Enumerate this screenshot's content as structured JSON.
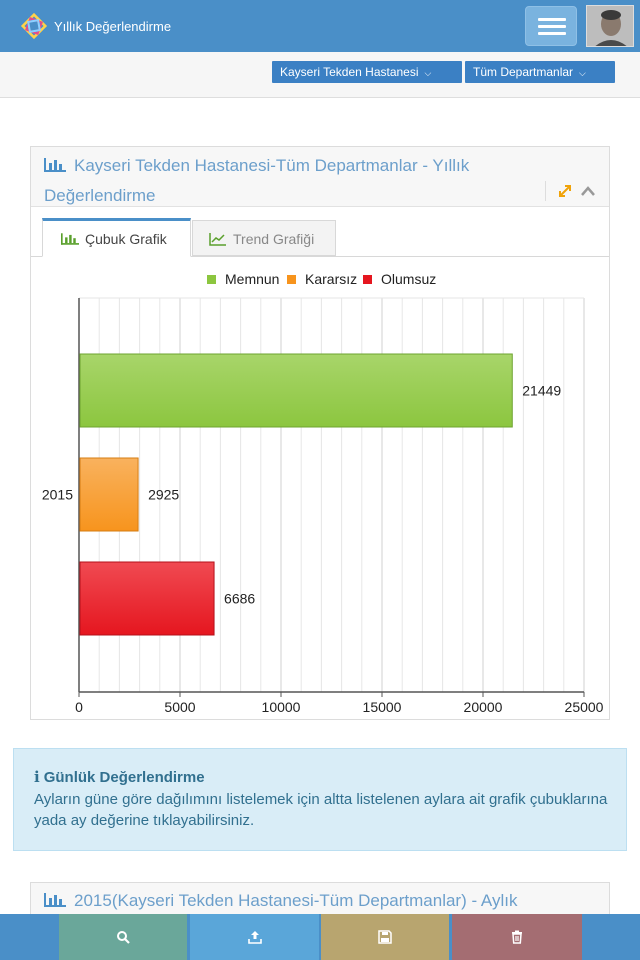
{
  "header": {
    "app_title": "Yıllık Değerlendirme",
    "menu_icon": "hamburger-menu-icon",
    "avatar": "user-avatar"
  },
  "filters": {
    "hospital": "Kayseri Tekden Hastanesi",
    "department": "Tüm Departmanlar"
  },
  "panel": {
    "title": "Kayseri Tekden Hastanesi-Tüm Departmanlar - Yıllık Değerlendirme",
    "tabs": [
      {
        "label": "Çubuk Grafik",
        "icon": "bar-chart-icon",
        "active": true
      },
      {
        "label": "Trend Grafiği",
        "icon": "line-chart-icon",
        "active": false
      }
    ]
  },
  "chart_data": {
    "type": "bar",
    "orientation": "horizontal",
    "categories": [
      "2015"
    ],
    "series": [
      {
        "name": "Memnun",
        "values": [
          21449
        ],
        "color": "#8cc63f"
      },
      {
        "name": "Kararsız",
        "values": [
          2925
        ],
        "color": "#f7941d"
      },
      {
        "name": "Olumsuz",
        "values": [
          6686
        ],
        "color": "#e5161f"
      }
    ],
    "xlim": [
      0,
      25000
    ],
    "xticks": [
      "0",
      "5000",
      "10000",
      "15000",
      "20000",
      "25000"
    ],
    "value_labels": [
      "21449",
      "2925",
      "6686"
    ],
    "legend": "top",
    "grid": true
  },
  "info": {
    "icon": "info-icon",
    "title": "Günlük Değerlendirme",
    "text": "Ayların güne göre dağılımını listelemek için altta listelenen aylara ait grafik çubuklarına yada ay değerine tıklayabilirsiniz."
  },
  "panel2": {
    "title": "2015(Kayseri Tekden Hastanesi-Tüm Departmanlar) - Aylık"
  },
  "bottom_bar": [
    {
      "icon": "search-icon",
      "color": "#6aa79a"
    },
    {
      "icon": "upload-icon",
      "color": "#5aa6d9"
    },
    {
      "icon": "save-icon",
      "color": "#b8a56f"
    },
    {
      "icon": "trash-icon",
      "color": "#a46d72"
    }
  ]
}
